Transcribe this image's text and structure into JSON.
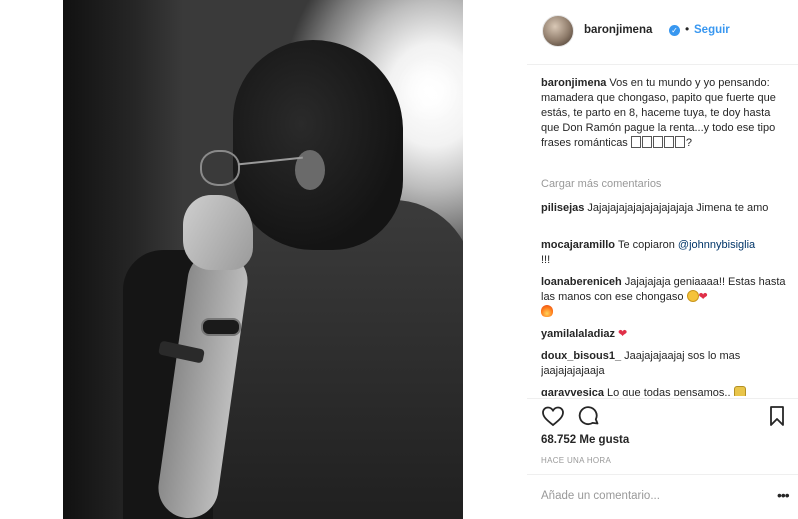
{
  "post": {
    "username": "baronjimena",
    "follow_label": "Seguir",
    "dot": "•",
    "verified_glyph": "✓"
  },
  "caption": {
    "username": "baronjimena",
    "text": "Vos en tu mundo y yo pensando: mamadera que chongaso, papito que fuerte que estás, te parto en 8, haceme tuya, te doy hasta que Don Ramón pague la renta...y todo ese tipo frases románticas",
    "suffix": "?"
  },
  "load_more_label": "Cargar más comentarios",
  "comments": [
    {
      "user": "pilisejas",
      "text": "Jajajajajajajajajajajaja Jimena te amo"
    },
    {
      "user": "mocajaramillo",
      "text_before": "Te copiaron",
      "mention": "@johnnybisiglia",
      "text_after": "!!!"
    },
    {
      "user": "loanabereniceh",
      "text": "Jajajajaja geniaaaa!! Estas hasta las manos con ese chongaso"
    },
    {
      "user": "yamilalaladiaz",
      "text": ""
    },
    {
      "user": "doux_bisous1_",
      "text": "Jaajajajaajaj sos lo mas jaajajajajaaja"
    },
    {
      "user": "garayvesica",
      "text": "Lo que todas pensamos.."
    }
  ],
  "actions": {
    "like_icon": "heart-outline-icon",
    "comment_icon": "comment-bubble-icon",
    "save_icon": "bookmark-icon"
  },
  "likes_label": "68.752 Me gusta",
  "timestamp": "HACE UNA HORA",
  "comment_input": {
    "placeholder": "Añade un comentario...",
    "more_label": "•••"
  },
  "colors": {
    "link_blue": "#3897f0",
    "mention_blue": "#003569",
    "muted_gray": "#999999",
    "text": "#262626",
    "heart_red": "#e02f48"
  }
}
